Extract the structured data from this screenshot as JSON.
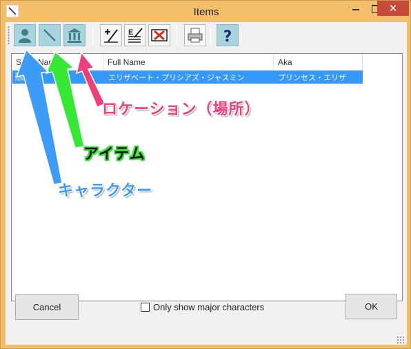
{
  "window": {
    "title": "Items",
    "close_glyph": "✕",
    "app_icon": "quill-icon",
    "frame_color": "#f4bf6a",
    "close_color": "#c74a3a"
  },
  "toolbar": {
    "buttons": [
      {
        "name": "character-icon"
      },
      {
        "name": "item-icon"
      },
      {
        "name": "location-icon"
      },
      {
        "name": "add-icon"
      },
      {
        "name": "edit-icon"
      },
      {
        "name": "delete-icon"
      },
      {
        "name": "print-icon"
      },
      {
        "name": "help-icon"
      }
    ],
    "help_glyph": "?"
  },
  "list": {
    "columns": [
      "Short Name",
      "Full Name",
      "Aka"
    ],
    "rows": [
      {
        "short_name": "",
        "full_name": "エリザベート・プリシアズ・ジャスミン",
        "aka": "プリンセス・エリザ"
      }
    ],
    "selection_color": "#3399ff"
  },
  "footer": {
    "cancel_label": "Cancel",
    "checkbox_label": "Only show major characters",
    "checkbox_checked": false,
    "ok_label": "OK"
  },
  "annotations": {
    "location": "ロケーション（場所）",
    "item": "アイテム",
    "character": "キャラクター",
    "colors": {
      "location": "#ef3e78",
      "item": "#34e834",
      "character": "#3d9cf7"
    }
  }
}
